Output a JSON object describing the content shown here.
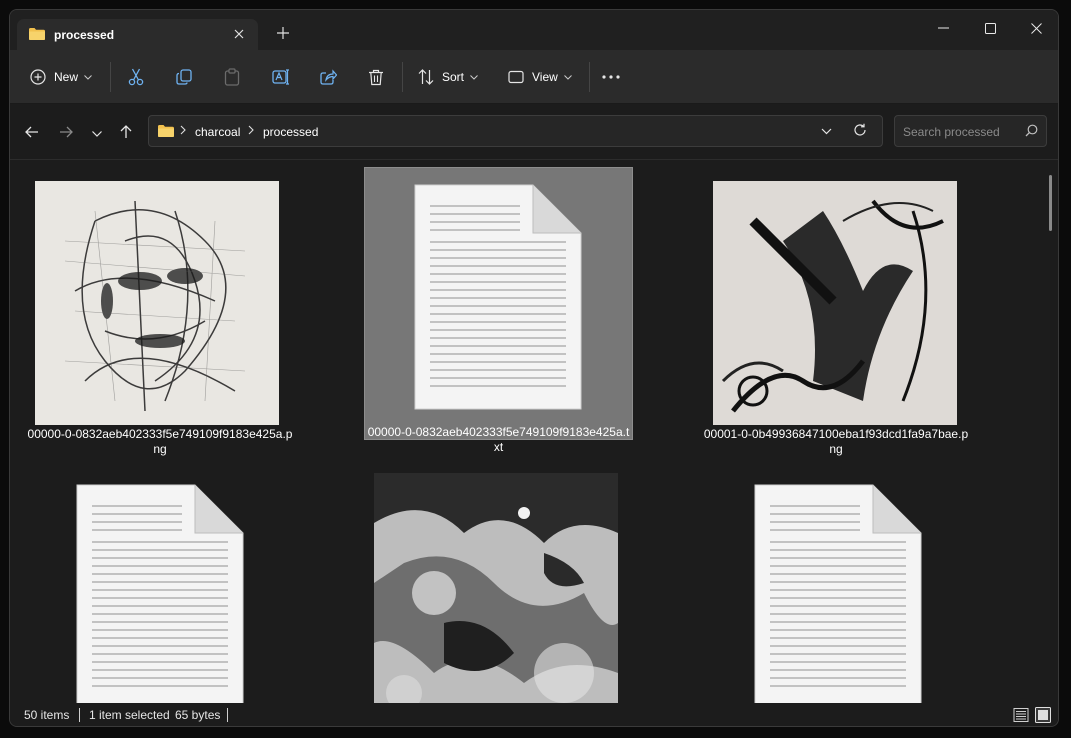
{
  "tab": {
    "title": "processed"
  },
  "toolbar": {
    "new_label": "New",
    "sort_label": "Sort",
    "view_label": "View"
  },
  "breadcrumb": [
    "charcoal",
    "processed"
  ],
  "search": {
    "placeholder": "Search processed"
  },
  "files": [
    {
      "name": "00000-0-0832aeb402333f5e749109f9183e425a.png",
      "type": "image",
      "selected": false
    },
    {
      "name": "00000-0-0832aeb402333f5e749109f9183e425a.txt",
      "type": "text",
      "selected": true
    },
    {
      "name": "00001-0-0b49936847100eba1f93dcd1fa9a7bae.png",
      "type": "image",
      "selected": false
    },
    {
      "name": "",
      "type": "text",
      "selected": false
    },
    {
      "name": "",
      "type": "image",
      "selected": false
    },
    {
      "name": "",
      "type": "text",
      "selected": false
    }
  ],
  "status": {
    "item_count": "50 items",
    "selection": "1 item selected",
    "size": "65 bytes"
  },
  "colors": {
    "folder": "#f2c14e",
    "selected_bg": "#777777",
    "window_bg": "#1c1c1c"
  }
}
